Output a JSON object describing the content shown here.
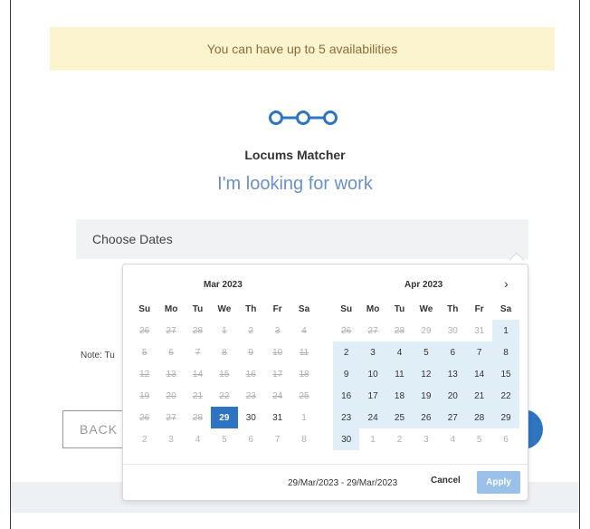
{
  "banner": {
    "text": "You can have up to 5 availabilities"
  },
  "brand": {
    "product_name": "Locums Matcher",
    "headline": "I'm looking for work",
    "logo_icon": "three-linked-circles-icon",
    "accent": "#2f74c0"
  },
  "dates_field": {
    "placeholder": "Choose Dates"
  },
  "note": {
    "text": "Note: Tu"
  },
  "back_button": {
    "label": "BACK"
  },
  "date_picker": {
    "weekdays": [
      "Su",
      "Mo",
      "Tu",
      "We",
      "Th",
      "Fr",
      "Sa"
    ],
    "next_arrow": "›",
    "months": [
      {
        "title": "Mar 2023",
        "days": [
          {
            "t": "26",
            "s": "dis"
          },
          {
            "t": "27",
            "s": "dis"
          },
          {
            "t": "28",
            "s": "dis"
          },
          {
            "t": "1",
            "s": "dis"
          },
          {
            "t": "2",
            "s": "dis"
          },
          {
            "t": "3",
            "s": "dis"
          },
          {
            "t": "4",
            "s": "dis"
          },
          {
            "t": "5",
            "s": "dis"
          },
          {
            "t": "6",
            "s": "dis"
          },
          {
            "t": "7",
            "s": "dis"
          },
          {
            "t": "8",
            "s": "dis"
          },
          {
            "t": "9",
            "s": "dis"
          },
          {
            "t": "10",
            "s": "dis"
          },
          {
            "t": "11",
            "s": "dis"
          },
          {
            "t": "12",
            "s": "dis"
          },
          {
            "t": "13",
            "s": "dis"
          },
          {
            "t": "14",
            "s": "dis"
          },
          {
            "t": "15",
            "s": "dis"
          },
          {
            "t": "16",
            "s": "dis"
          },
          {
            "t": "17",
            "s": "dis"
          },
          {
            "t": "18",
            "s": "dis"
          },
          {
            "t": "19",
            "s": "dis"
          },
          {
            "t": "20",
            "s": "dis"
          },
          {
            "t": "21",
            "s": "dis"
          },
          {
            "t": "22",
            "s": "dis"
          },
          {
            "t": "23",
            "s": "dis"
          },
          {
            "t": "24",
            "s": "dis"
          },
          {
            "t": "25",
            "s": "dis"
          },
          {
            "t": "26",
            "s": "dis"
          },
          {
            "t": "27",
            "s": "dis"
          },
          {
            "t": "28",
            "s": "dis"
          },
          {
            "t": "29",
            "s": "sel"
          },
          {
            "t": "30",
            "s": "on"
          },
          {
            "t": "31",
            "s": "on"
          },
          {
            "t": "1",
            "s": "off"
          },
          {
            "t": "2",
            "s": "off"
          },
          {
            "t": "3",
            "s": "off"
          },
          {
            "t": "4",
            "s": "off"
          },
          {
            "t": "5",
            "s": "off"
          },
          {
            "t": "6",
            "s": "off"
          },
          {
            "t": "7",
            "s": "off"
          },
          {
            "t": "8",
            "s": "off"
          }
        ]
      },
      {
        "title": "Apr 2023",
        "days": [
          {
            "t": "26",
            "s": "dis"
          },
          {
            "t": "27",
            "s": "dis"
          },
          {
            "t": "28",
            "s": "dis"
          },
          {
            "t": "29",
            "s": "off"
          },
          {
            "t": "30",
            "s": "off"
          },
          {
            "t": "31",
            "s": "off"
          },
          {
            "t": "1",
            "s": "in"
          },
          {
            "t": "2",
            "s": "in"
          },
          {
            "t": "3",
            "s": "in"
          },
          {
            "t": "4",
            "s": "in"
          },
          {
            "t": "5",
            "s": "in"
          },
          {
            "t": "6",
            "s": "in"
          },
          {
            "t": "7",
            "s": "in"
          },
          {
            "t": "8",
            "s": "in"
          },
          {
            "t": "9",
            "s": "in"
          },
          {
            "t": "10",
            "s": "in"
          },
          {
            "t": "11",
            "s": "in"
          },
          {
            "t": "12",
            "s": "in"
          },
          {
            "t": "13",
            "s": "in"
          },
          {
            "t": "14",
            "s": "in"
          },
          {
            "t": "15",
            "s": "in"
          },
          {
            "t": "16",
            "s": "in"
          },
          {
            "t": "17",
            "s": "in"
          },
          {
            "t": "18",
            "s": "in"
          },
          {
            "t": "19",
            "s": "in"
          },
          {
            "t": "20",
            "s": "in"
          },
          {
            "t": "21",
            "s": "in"
          },
          {
            "t": "22",
            "s": "in"
          },
          {
            "t": "23",
            "s": "in"
          },
          {
            "t": "24",
            "s": "in"
          },
          {
            "t": "25",
            "s": "in"
          },
          {
            "t": "26",
            "s": "in"
          },
          {
            "t": "27",
            "s": "in"
          },
          {
            "t": "28",
            "s": "in"
          },
          {
            "t": "29",
            "s": "in"
          },
          {
            "t": "30",
            "s": "in"
          },
          {
            "t": "1",
            "s": "off"
          },
          {
            "t": "2",
            "s": "off"
          },
          {
            "t": "3",
            "s": "off"
          },
          {
            "t": "4",
            "s": "off"
          },
          {
            "t": "5",
            "s": "off"
          },
          {
            "t": "6",
            "s": "off"
          }
        ]
      }
    ],
    "range_text": "29/Mar/2023 - 29/Mar/2023",
    "cancel_label": "Cancel",
    "apply_label": "Apply"
  }
}
